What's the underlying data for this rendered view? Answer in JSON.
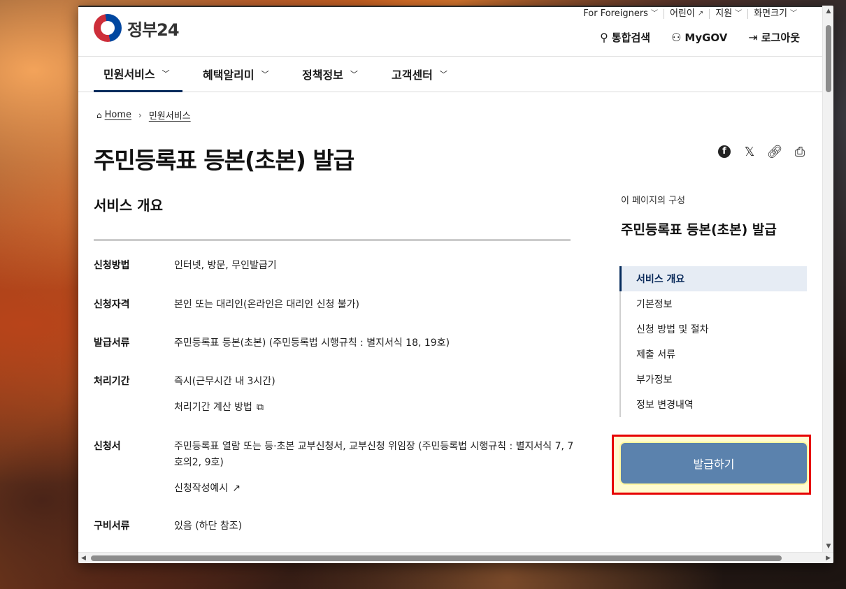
{
  "header": {
    "logo_text": "정부24",
    "util_links": [
      "For Foreigners",
      "어린이",
      "지원",
      "화면크기"
    ],
    "actions": [
      "통합검색",
      "MyGOV",
      "로그아웃"
    ]
  },
  "gnb": {
    "items": [
      "민원서비스",
      "혜택알리미",
      "정책정보",
      "고객센터"
    ]
  },
  "breadcrumb": {
    "home": "Home",
    "current": "민원서비스"
  },
  "page": {
    "title": "주민등록표 등본(초본) 발급",
    "section_title": "서비스 개요"
  },
  "info": [
    {
      "label": "신청방법",
      "value": "인터넷, 방문, 무인발급기"
    },
    {
      "label": "신청자격",
      "value": "본인 또는 대리인(온라인은 대리인 신청 불가)"
    },
    {
      "label": "발급서류",
      "value": "주민등록표 등본(초본) (주민등록법 시행규칙 : 별지서식 18, 19호)"
    },
    {
      "label": "처리기간",
      "value": "즉시(근무시간 내 3시간)",
      "sub": "처리기간 계산 방법"
    },
    {
      "label": "신청서",
      "value": "주민등록표 열람 또는 등·초본 교부신청서, 교부신청 위임장 (주민등록법 시행규칙 : 별지서식 7, 7호의2, 9호)",
      "sub": "신청작성예시"
    },
    {
      "label": "구비서류",
      "value": "있음 (하단 참조)"
    }
  ],
  "toc": {
    "caption": "이 페이지의 구성",
    "title": "주민등록표 등본(초본) 발급",
    "items": [
      "서비스 개요",
      "기본정보",
      "신청 방법 및 절차",
      "제출 서류",
      "부가정보",
      "정보 변경내역"
    ]
  },
  "issue_button": "발급하기",
  "colors": {
    "primary": "#052b5c",
    "button": "#5b82ad",
    "highlight": "#e60000"
  }
}
